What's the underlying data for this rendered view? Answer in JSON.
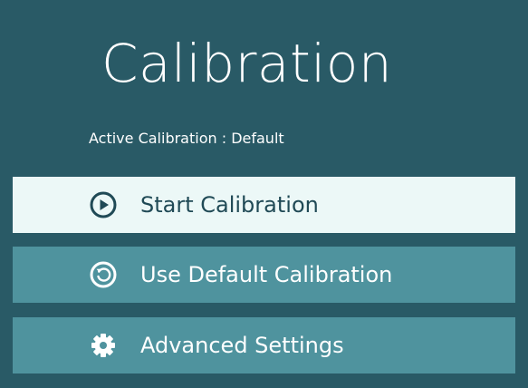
{
  "title": "Calibration",
  "active_calibration": "Active Calibration : Default",
  "buttons": [
    {
      "label": "Start Calibration",
      "icon": "play-circle-icon"
    },
    {
      "label": "Use Default Calibration",
      "icon": "restore-icon"
    },
    {
      "label": "Advanced Settings",
      "icon": "gear-icon"
    }
  ],
  "colors": {
    "background": "#295a66",
    "primary_button": "#ecf8f7",
    "primary_text": "#204a56",
    "secondary_button": "#4f939e",
    "text_light": "#ffffff"
  }
}
